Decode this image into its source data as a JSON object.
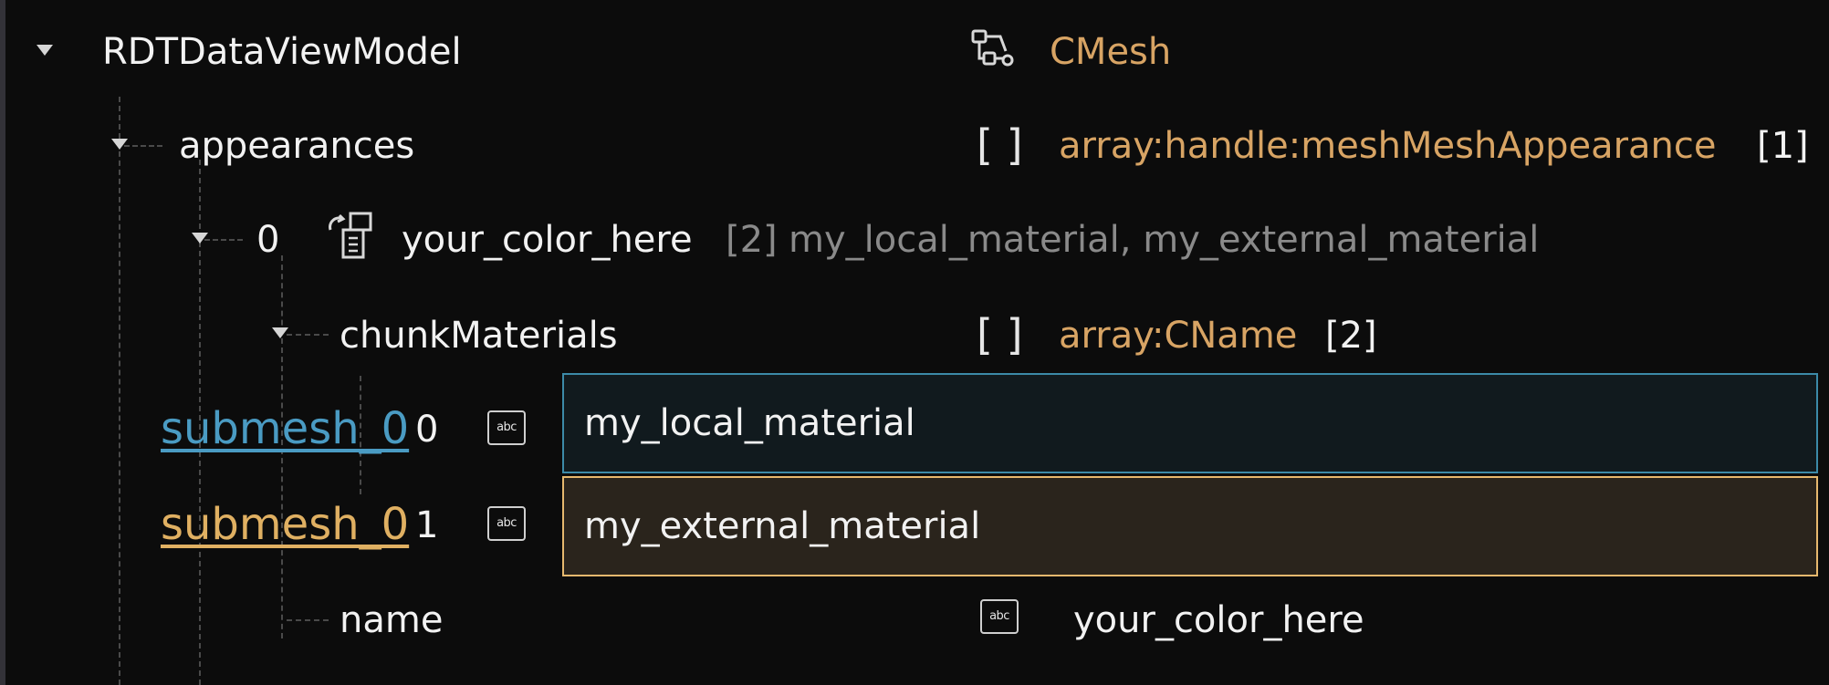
{
  "root": {
    "label": "RDTDataViewModel",
    "type_label": "CMesh",
    "type_icon": "mesh-nodes-icon"
  },
  "appearances": {
    "label": "appearances",
    "bracket": "[ ]",
    "type_label": "array:handle:meshMeshAppearance",
    "count": "[1]"
  },
  "appearance_item": {
    "index": "0",
    "icon": "appearance-switch-icon",
    "name": "your_color_here",
    "count": "[2]",
    "summary": "my_local_material, my_external_material"
  },
  "chunk_materials": {
    "label": "chunkMaterials",
    "bracket": "[ ]",
    "type_label": "array:CName",
    "count": "[2]"
  },
  "chunk_rows": [
    {
      "overlay_label": "submesh_0",
      "index": "0",
      "value": "my_local_material",
      "icon": "abc-text-icon",
      "accent": "#4a9bc3"
    },
    {
      "overlay_label": "submesh_0",
      "index": "1",
      "value": "my_external_material",
      "icon": "abc-text-icon",
      "accent": "#e0b062"
    }
  ],
  "name_row": {
    "label": "name",
    "icon": "abc-text-icon",
    "value": "your_color_here"
  },
  "icon_text": {
    "abc": "abc"
  },
  "colors": {
    "background": "#0c0c0c",
    "type_gold": "#d8a464",
    "selected_blue_border": "#3c8aa8",
    "selected_gold_border": "#e6b86e"
  }
}
